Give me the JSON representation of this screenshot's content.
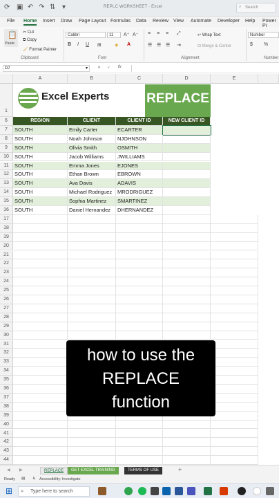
{
  "window": {
    "doc_title": "REPLC WORKSHEET · Excel",
    "search_placeholder": "Search"
  },
  "menu": {
    "items": [
      "File",
      "Home",
      "Insert",
      "Draw",
      "Page Layout",
      "Formulas",
      "Data",
      "Review",
      "View",
      "Automate",
      "Developer",
      "Help",
      "Power Pi"
    ],
    "active": "Home"
  },
  "ribbon": {
    "clipboard": {
      "paste": "Paste",
      "cut": "Cut",
      "copy": "Copy",
      "format_painter": "Format Painter",
      "group": "Clipboard"
    },
    "font": {
      "name": "Calibri",
      "size": "11",
      "group": "Font",
      "bold": "B",
      "italic": "I",
      "underline": "U"
    },
    "alignment": {
      "wrap": "Wrap Text",
      "merge": "Merge & Center",
      "group": "Alignment"
    },
    "number": {
      "format": "Number",
      "currency": "$",
      "percent": "%",
      "group": "Number"
    }
  },
  "formula_bar": {
    "name_box": "D7",
    "fx": "fx",
    "value": ""
  },
  "columns": [
    "A",
    "B",
    "C",
    "D",
    "E"
  ],
  "logo": {
    "text": "Excel Experts",
    "banner": "REPLACE"
  },
  "table": {
    "headers": [
      "REGION",
      "CLIENT",
      "CLIENT ID",
      "NEW CLIENT ID"
    ],
    "rows": [
      [
        "SOUTH",
        "Emily Carter",
        "ECARTER",
        ""
      ],
      [
        "SOUTH",
        "Noah Johnson",
        "NJOHNSON",
        ""
      ],
      [
        "SOUTH",
        "Olivia Smith",
        "OSMITH",
        ""
      ],
      [
        "SOUTH",
        "Jacob Williams",
        "JWILLIAMS",
        ""
      ],
      [
        "SOUTH",
        "Emma Jones",
        "EJONES",
        ""
      ],
      [
        "SOUTH",
        "Ethan Brown",
        "EBROWN",
        ""
      ],
      [
        "SOUTH",
        "Ava Davis",
        "ADAVIS",
        ""
      ],
      [
        "SOUTH",
        "Michael Rodriguez",
        "MRODRIGUEZ",
        ""
      ],
      [
        "SOUTH",
        "Sophia Martinez",
        "SMARTINEZ",
        ""
      ],
      [
        "SOUTH",
        "Daniel Hernandez",
        "DHERNANDEZ",
        ""
      ]
    ]
  },
  "row_numbers": [
    "1",
    "6",
    "7",
    "8",
    "9",
    "10",
    "11",
    "12",
    "13",
    "14",
    "15",
    "16",
    "17",
    "18",
    "19",
    "20",
    "21",
    "22",
    "23",
    "24",
    "25",
    "26",
    "27",
    "28",
    "29",
    "30",
    "31",
    "32",
    "33",
    "34",
    "35",
    "36",
    "37",
    "38",
    "39",
    "40",
    "41",
    "42",
    "43",
    "44"
  ],
  "overlay": {
    "line1": "how to use the",
    "line2": "REPLACE",
    "line3": "function"
  },
  "sheet_tabs": [
    {
      "label": "REPLACE",
      "color": "#e8e8e8",
      "text_color": "#1e6e3a"
    },
    {
      "label": "GET EXCEL TRAINING",
      "color": "#6aa84f",
      "text_color": "#ffffff"
    },
    {
      "label": "TERMS OF USE",
      "color": "#333333",
      "text_color": "#ffffff"
    }
  ],
  "status": {
    "ready": "Ready",
    "accessibility": "Accessibility: Investigate"
  },
  "taskbar": {
    "search_placeholder": "Type here to search"
  },
  "colors": {
    "header_green": "#375623",
    "band_green": "#e2efda",
    "logo_green": "#6aa84f"
  }
}
